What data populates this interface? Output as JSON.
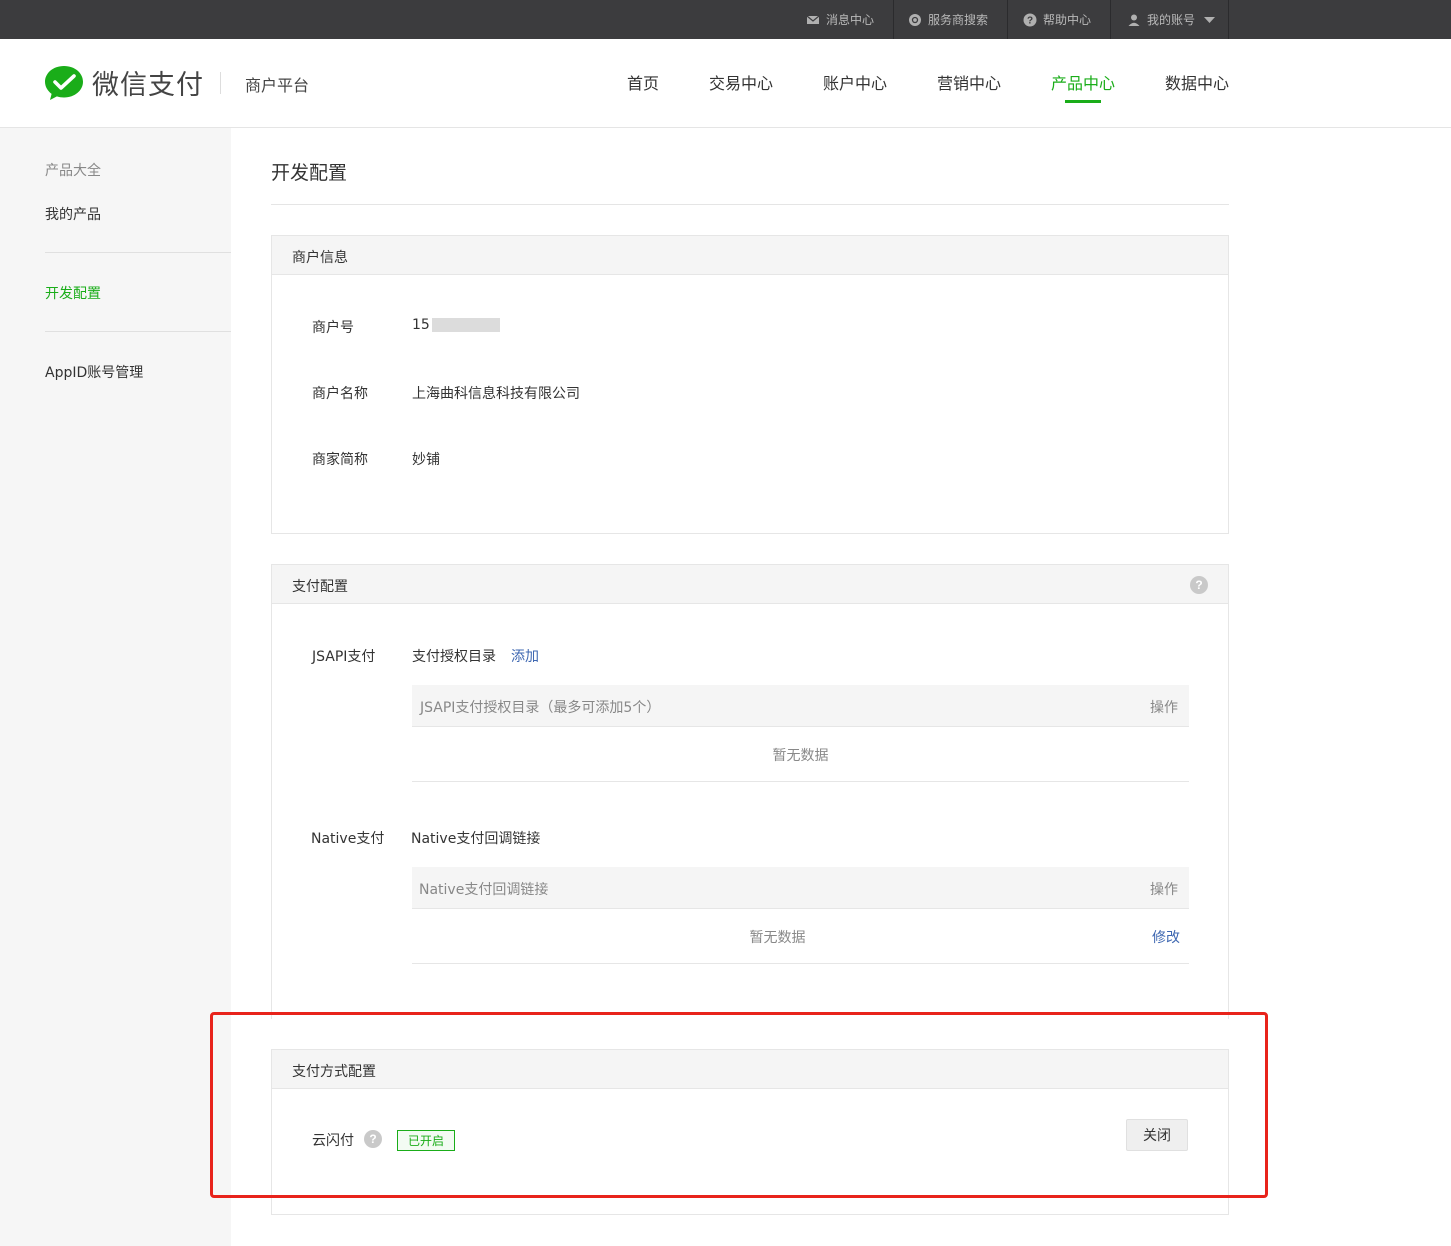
{
  "topbar": {
    "messages": "消息中心",
    "provider_search": "服务商搜索",
    "help": "帮助中心",
    "account": "我的账号"
  },
  "header": {
    "brand": "微信支付",
    "subtitle": "商户平台",
    "nav": [
      "首页",
      "交易中心",
      "账户中心",
      "营销中心",
      "产品中心",
      "数据中心"
    ],
    "active_nav": "产品中心",
    "accent_color": "#1aad19"
  },
  "sidebar": {
    "items": [
      "产品大全",
      "我的产品",
      "开发配置",
      "AppID账号管理"
    ],
    "active": "开发配置"
  },
  "page": {
    "title": "开发配置"
  },
  "merchant_info": {
    "title": "商户信息",
    "fields": [
      {
        "label": "商户号",
        "value": "15"
      },
      {
        "label": "商户名称",
        "value": "上海曲科信息科技有限公司"
      },
      {
        "label": "商家简称",
        "value": "妙铺"
      }
    ]
  },
  "payment_config": {
    "title": "支付配置",
    "jsapi": {
      "label": "JSAPI支付",
      "sub_label": "支付授权目录",
      "add_link": "添加",
      "table_header": "JSAPI支付授权目录（最多可添加5个）",
      "op_header": "操作",
      "empty": "暂无数据"
    },
    "native": {
      "label": "Native支付",
      "sub_label": "Native支付回调链接",
      "table_header": "Native支付回调链接",
      "op_header": "操作",
      "empty": "暂无数据",
      "edit_link": "修改"
    }
  },
  "pay_method_config": {
    "title": "支付方式配置",
    "item_label": "云闪付",
    "status": "已开启",
    "close_button": "关闭"
  }
}
